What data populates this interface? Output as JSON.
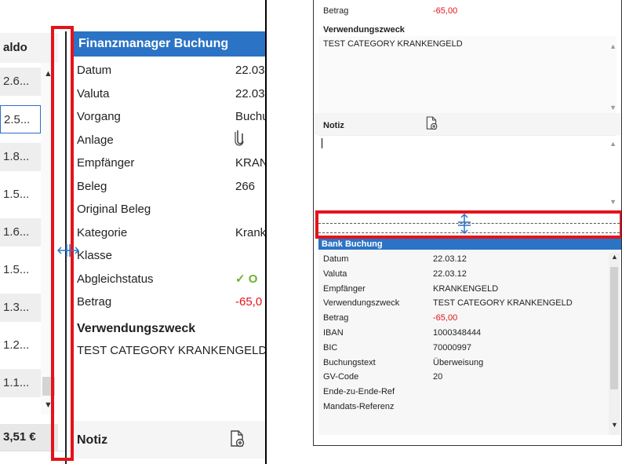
{
  "left": {
    "saldo_header": "aldo",
    "saldo_rows": [
      "2.6...",
      "2.5...",
      "1.8...",
      "1.5...",
      "1.6...",
      "1.5...",
      "1.3...",
      "1.2...",
      "1.1..."
    ],
    "saldo_total": "3,51 €",
    "detail_title": "Finanzmanager Buchung",
    "fields": [
      {
        "label": "Datum",
        "value": "22.03"
      },
      {
        "label": "Valuta",
        "value": "22.03"
      },
      {
        "label": "Vorgang",
        "value": "Buchu"
      },
      {
        "label": "Anlage",
        "value": ""
      },
      {
        "label": "Empfänger",
        "value": "KRAN"
      },
      {
        "label": "Beleg",
        "value": "266"
      },
      {
        "label": "Original Beleg",
        "value": ""
      },
      {
        "label": "Kategorie",
        "value": "Krank"
      },
      {
        "label": "Klasse",
        "value": ""
      },
      {
        "label": "Abgleichstatus",
        "value": "✓ O"
      },
      {
        "label": "Betrag",
        "value": "-65,0"
      }
    ],
    "verwendungszweck_label": "Verwendungszweck",
    "verwendungszweck_text": "TEST CATEGORY KRANKENGELD",
    "notiz_label": "Notiz"
  },
  "right": {
    "betrag_label": "Betrag",
    "betrag_value": "-65,00",
    "verwendungszweck_label": "Verwendungszweck",
    "verwendungszweck_text": "TEST CATEGORY KRANKENGELD",
    "notiz_label": "Notiz",
    "bank_title": "Bank Buchung",
    "bank_fields": [
      {
        "label": "Datum",
        "value": "22.03.12"
      },
      {
        "label": "Valuta",
        "value": "22.03.12"
      },
      {
        "label": "Empfänger",
        "value": "KRANKENGELD"
      },
      {
        "label": "Verwendungszweck",
        "value": "TEST CATEGORY KRANKENGELD"
      },
      {
        "label": "Betrag",
        "value": "-65,00"
      },
      {
        "label": "IBAN",
        "value": "1000348444"
      },
      {
        "label": "BIC",
        "value": "70000997"
      },
      {
        "label": "Buchungstext",
        "value": "Überweisung"
      },
      {
        "label": "GV-Code",
        "value": "20"
      },
      {
        "label": "Ende-zu-Ende-Ref",
        "value": ""
      },
      {
        "label": "Mandats-Referenz",
        "value": ""
      }
    ]
  },
  "colors": {
    "accent": "#2b73c4",
    "highlight": "#e4131b",
    "check": "#6bb42a"
  },
  "icons": [
    "attachment-icon",
    "add-note-icon",
    "split-cursor-icon",
    "scroll-up-icon",
    "scroll-down-icon"
  ]
}
